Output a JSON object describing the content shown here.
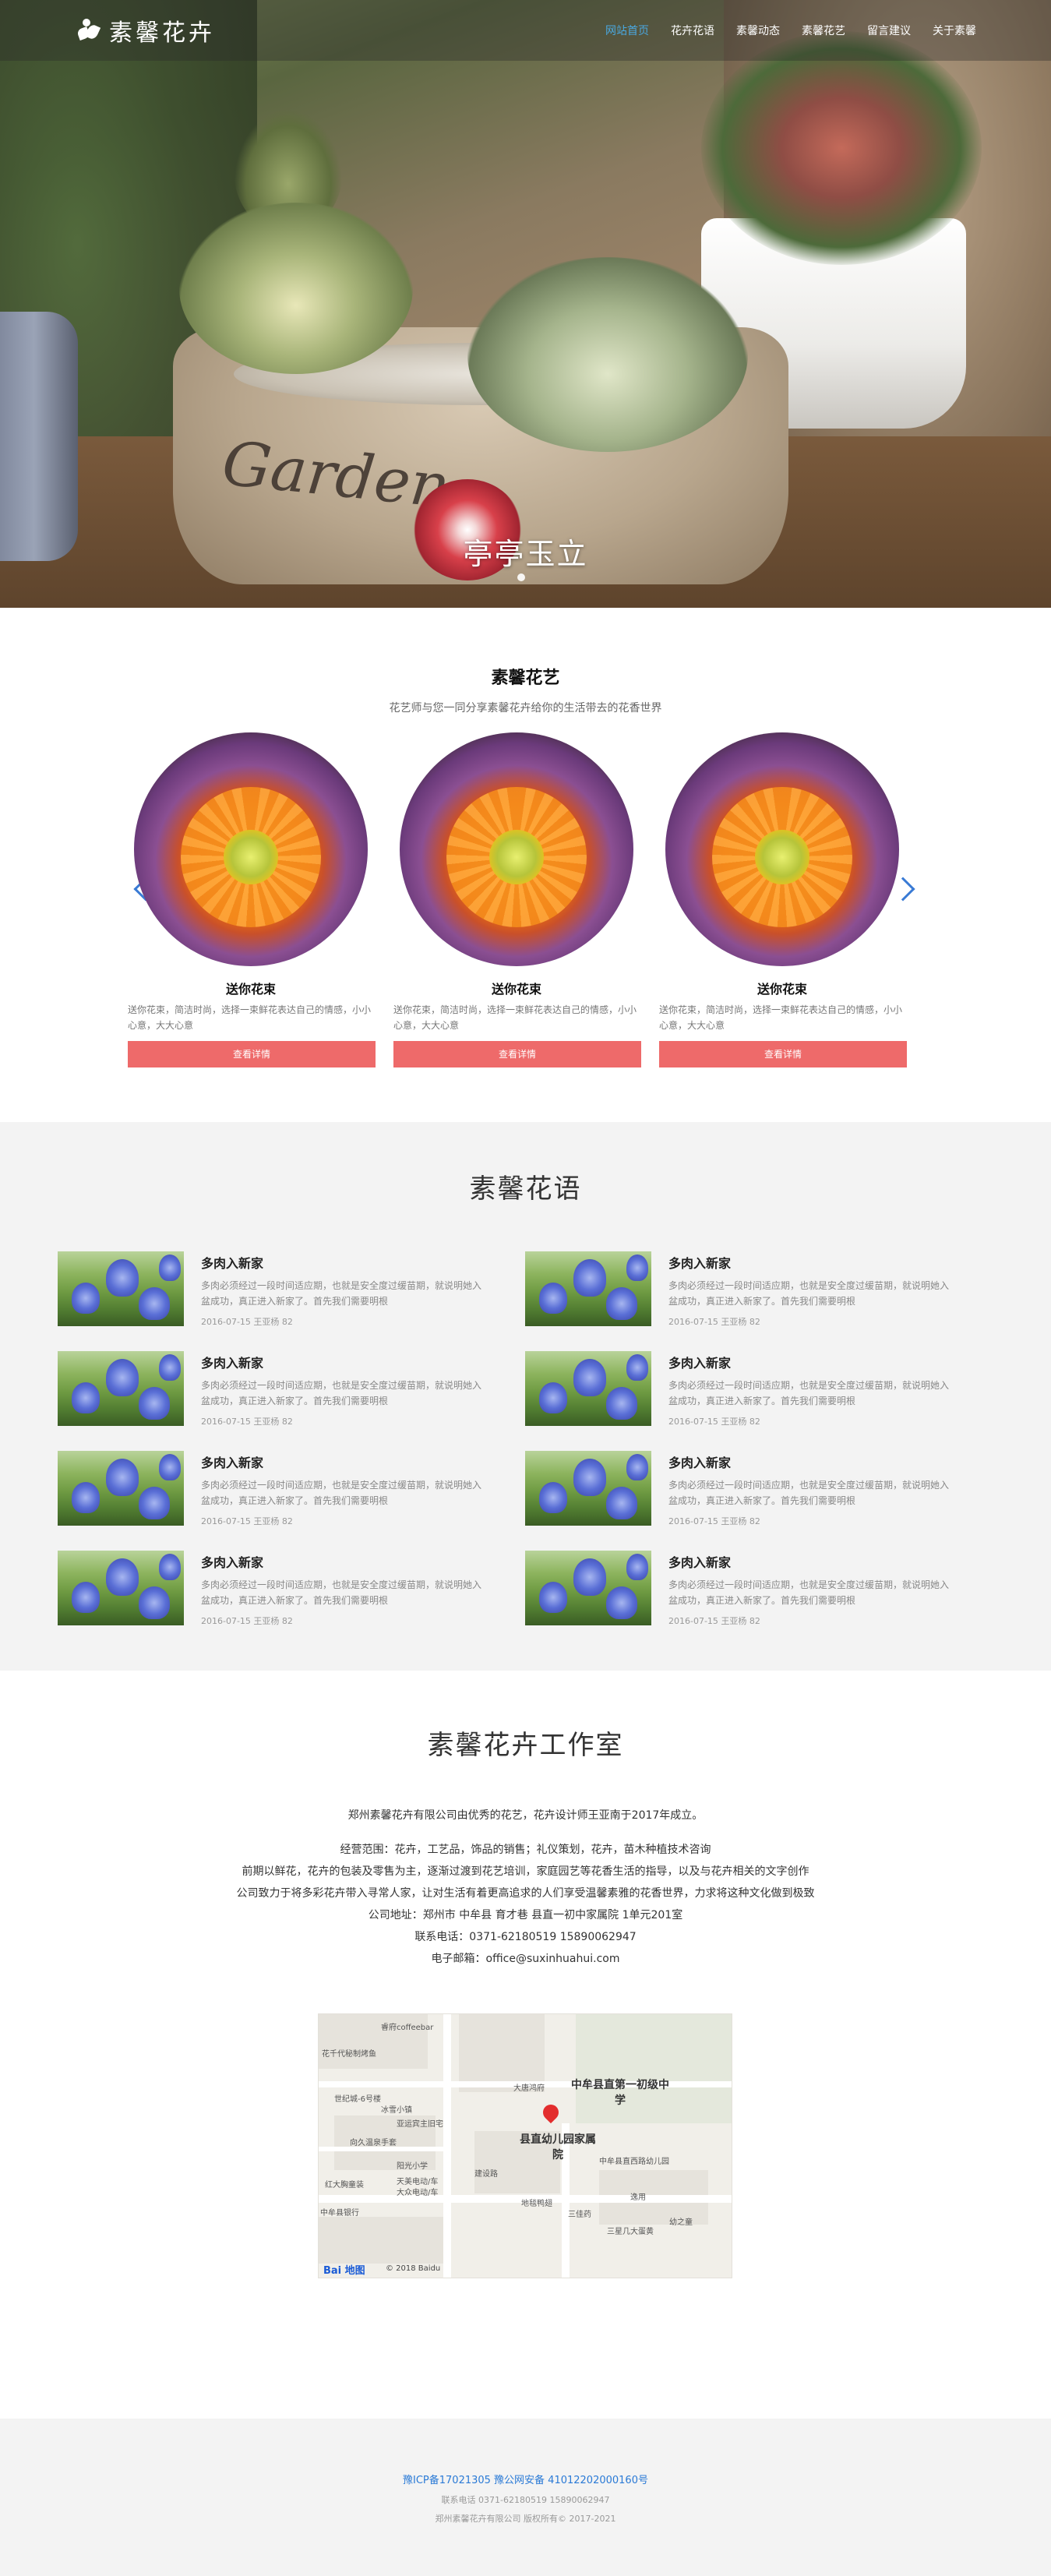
{
  "brand": {
    "title": "素馨花卉",
    "accent": "#4aa8e0",
    "button_color": "#ee6a6a"
  },
  "nav": {
    "items": [
      {
        "label": "网站首页",
        "active": true
      },
      {
        "label": "花卉花语",
        "active": false
      },
      {
        "label": "素馨动态",
        "active": false
      },
      {
        "label": "素馨花艺",
        "active": false
      },
      {
        "label": "留言建议",
        "active": false
      },
      {
        "label": "关于素馨",
        "active": false
      }
    ]
  },
  "hero": {
    "caption": "亭亭玉立",
    "garden_text": "Garden"
  },
  "art": {
    "title": "素馨花艺",
    "subtitle": "花艺师与您一同分享素馨花卉给你的生活带去的花香世界",
    "cards": [
      {
        "name": "送你花束",
        "desc": "送你花束，简洁时尚，选择一束鲜花表达自己的情感，小小心意，大大心意",
        "button": "查看详情"
      },
      {
        "name": "送你花束",
        "desc": "送你花束，简洁时尚，选择一束鲜花表达自己的情感，小小心意，大大心意",
        "button": "查看详情"
      },
      {
        "name": "送你花束",
        "desc": "送你花束，简洁时尚，选择一束鲜花表达自己的情感，小小心意，大大心意",
        "button": "查看详情"
      }
    ]
  },
  "lang": {
    "title": "素馨花语",
    "items": [
      {
        "title": "多肉入新家",
        "desc": "多肉必须经过一段时间适应期，也就是安全度过缓苗期，就说明她入盆成功，真正进入新家了。首先我们需要明根",
        "meta": "2016-07-15 王亚杨 82"
      },
      {
        "title": "多肉入新家",
        "desc": "多肉必须经过一段时间适应期，也就是安全度过缓苗期，就说明她入盆成功，真正进入新家了。首先我们需要明根",
        "meta": "2016-07-15 王亚杨 82"
      },
      {
        "title": "多肉入新家",
        "desc": "多肉必须经过一段时间适应期，也就是安全度过缓苗期，就说明她入盆成功，真正进入新家了。首先我们需要明根",
        "meta": "2016-07-15 王亚杨 82"
      },
      {
        "title": "多肉入新家",
        "desc": "多肉必须经过一段时间适应期，也就是安全度过缓苗期，就说明她入盆成功，真正进入新家了。首先我们需要明根",
        "meta": "2016-07-15 王亚杨 82"
      },
      {
        "title": "多肉入新家",
        "desc": "多肉必须经过一段时间适应期，也就是安全度过缓苗期，就说明她入盆成功，真正进入新家了。首先我们需要明根",
        "meta": "2016-07-15 王亚杨 82"
      },
      {
        "title": "多肉入新家",
        "desc": "多肉必须经过一段时间适应期，也就是安全度过缓苗期，就说明她入盆成功，真正进入新家了。首先我们需要明根",
        "meta": "2016-07-15 王亚杨 82"
      },
      {
        "title": "多肉入新家",
        "desc": "多肉必须经过一段时间适应期，也就是安全度过缓苗期，就说明她入盆成功，真正进入新家了。首先我们需要明根",
        "meta": "2016-07-15 王亚杨 82"
      },
      {
        "title": "多肉入新家",
        "desc": "多肉必须经过一段时间适应期，也就是安全度过缓苗期，就说明她入盆成功，真正进入新家了。首先我们需要明根",
        "meta": "2016-07-15 王亚杨 82"
      }
    ]
  },
  "studio": {
    "title": "素馨花卉工作室",
    "intro": "郑州素馨花卉有限公司由优秀的花艺，花卉设计师王亚南于2017年成立。",
    "scope": "经营范围：花卉，工艺品，饰品的销售；礼仪策划，花卉，苗木种植技术咨询",
    "story": "前期以鲜花，花卉的包装及零售为主，逐渐过渡到花艺培训，家庭园艺等花香生活的指导，以及与花卉相关的文字创作",
    "mission": "公司致力于将多彩花卉带入寻常人家，让对生活有着更高追求的人们享受温馨素雅的花香世界，力求将这种文化做到极致",
    "address": "公司地址：郑州市 中牟县 育才巷 县直一初中家属院 1单元201室",
    "phone": "联系电话：0371-62180519 15890062947",
    "email": "电子邮箱：office@suxinhuahui.com"
  },
  "map": {
    "labels": [
      "睿府coffeebar",
      "花千代秘制烤鱼",
      "世纪城-6号楼",
      "大唐鸿府",
      "冰雪小镇",
      "亚运宾主旧宅",
      "向久温泉手套",
      "阳光小学",
      "红大胸童装",
      "天美电动/车",
      "大众电动/车",
      "中牟县银行",
      "地毯鸭翅",
      "三佳药",
      "中牟县直西路幼儿园",
      "逸用",
      "幼之童",
      "三星几大蛋黄",
      "建设路"
    ],
    "highlight_school": "中牟县直第一初级中学",
    "highlight_target": "县直幼儿园家属院",
    "brand": "Bai 地图",
    "copyright": "© 2018 Baidu"
  },
  "footer": {
    "icp": "豫ICP备17021305 豫公网安备 41012202000160号",
    "contact": "联系电话 0371-62180519 15890062947",
    "copyright": "郑州素馨花卉有限公司 版权所有© 2017-2021"
  }
}
